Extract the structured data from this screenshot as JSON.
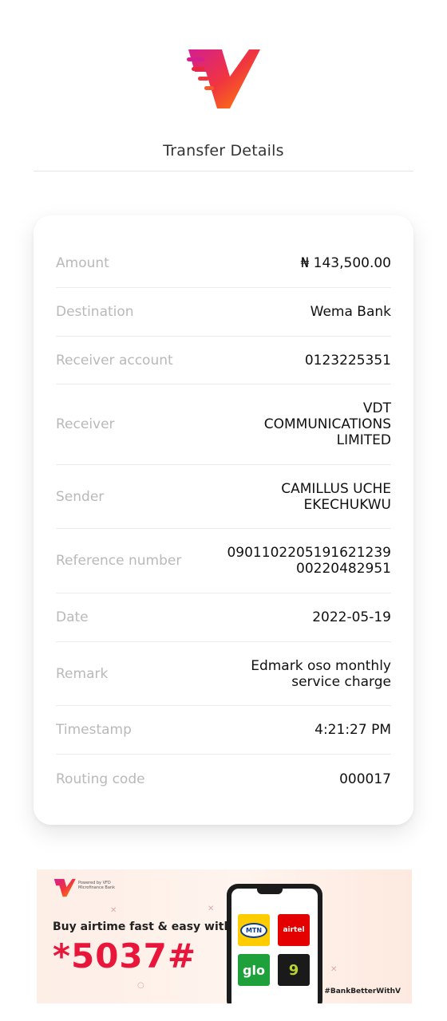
{
  "header": {
    "title": "Transfer Details"
  },
  "details": [
    {
      "label": "Amount",
      "value": "₦ 143,500.00"
    },
    {
      "label": "Destination",
      "value": "Wema Bank"
    },
    {
      "label": "Receiver account",
      "value": "0123225351"
    },
    {
      "label": "Receiver",
      "value": "VDT COMMUNICATIONS LIMITED"
    },
    {
      "label": "Sender",
      "value": "CAMILLUS UCHE EKECHUKWU"
    },
    {
      "label": "Reference number",
      "value": "090110220519162123900220482951"
    },
    {
      "label": "Date",
      "value": "2022-05-19"
    },
    {
      "label": "Remark",
      "value": "Edmark oso monthly service charge"
    },
    {
      "label": "Timestamp",
      "value": "4:21:27 PM"
    },
    {
      "label": "Routing code",
      "value": "000017"
    }
  ],
  "reference_lines": [
    "0901102205191621239",
    "00220482951"
  ],
  "receiver_lines": [
    "VDT",
    "COMMUNICATIONS",
    "LIMITED"
  ],
  "sender_lines": [
    "CAMILLUS UCHE",
    "EKECHUKWU"
  ],
  "remark_lines": [
    "Edmark oso monthly",
    "service charge"
  ],
  "banner": {
    "powered_by": "Powered by VFD Microfinance Bank",
    "headline": "Buy airtime fast & easy with",
    "ussd_code": "*5037#",
    "hashtag": "#BankBetterWithV",
    "networks": [
      "MTN",
      "airtel",
      "glo",
      "9mobile"
    ]
  },
  "colors": {
    "brand_start": "#d41f8f",
    "brand_end": "#ff8a00",
    "ussd": "#e8163a"
  }
}
